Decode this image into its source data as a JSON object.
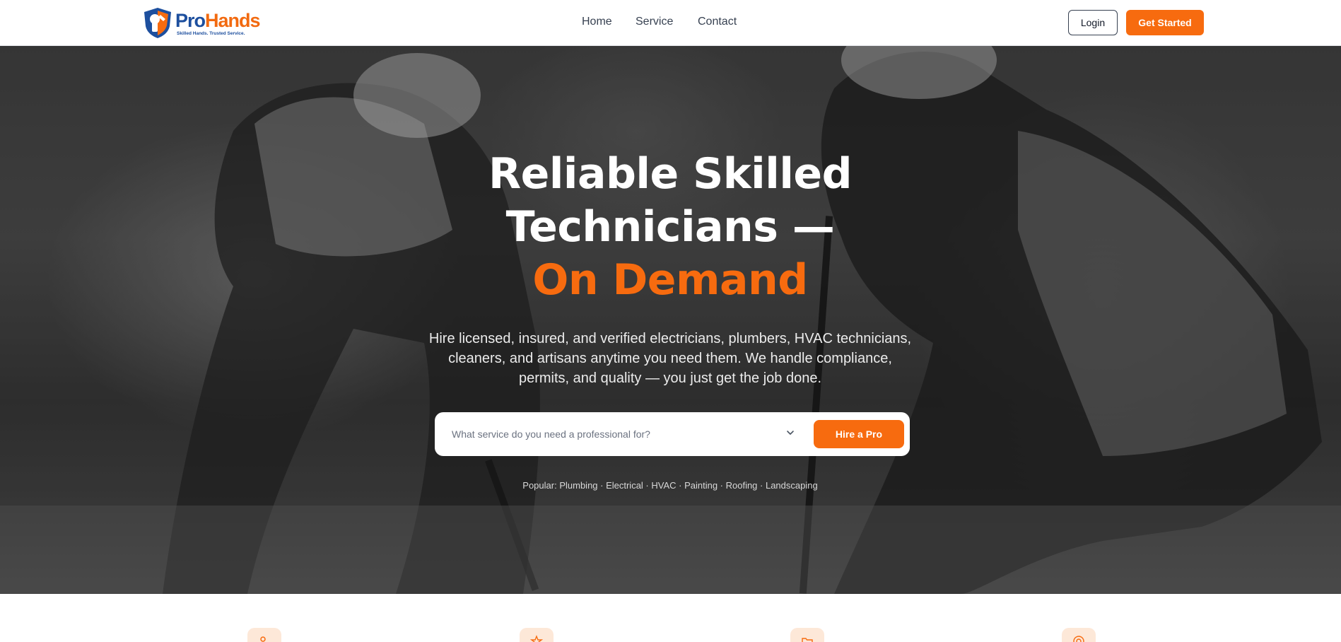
{
  "brand": {
    "name_part1": "Pro",
    "name_part2": "Hands",
    "tagline": "Skilled Hands. Trusted Service.",
    "primary_color": "#1d4f9e",
    "accent_color": "#f76b0f"
  },
  "nav": {
    "items": [
      {
        "label": "Home"
      },
      {
        "label": "Service"
      },
      {
        "label": "Contact"
      }
    ]
  },
  "header_actions": {
    "login_label": "Login",
    "get_started_label": "Get Started"
  },
  "hero": {
    "title_line1": "Reliable Skilled",
    "title_line2": "Technicians —",
    "title_accent": "On Demand",
    "description": "Hire licensed, insured, and verified electricians, plumbers, HVAC technicians, cleaners, and artisans anytime you need them. We handle compliance, permits, and quality — you just get the job done.",
    "search": {
      "placeholder": "What service do you need a professional for?",
      "button_label": "Hire a Pro"
    },
    "popular_label": "Popular:",
    "popular_items": "Plumbing · Electrical · HVAC · Painting · Roofing · Landscaping"
  },
  "features": {
    "icons": [
      "users-icon",
      "star-icon",
      "folder-icon",
      "target-icon"
    ]
  }
}
